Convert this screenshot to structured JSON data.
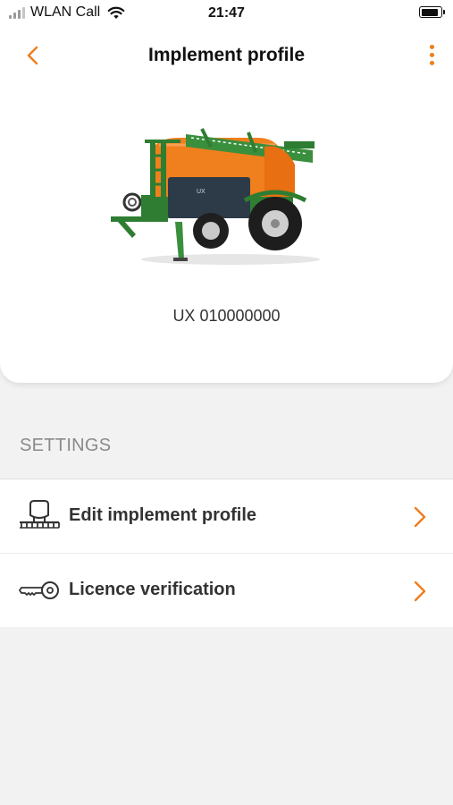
{
  "status_bar": {
    "carrier": "WLAN Call",
    "time": "21:47"
  },
  "header": {
    "title": "Implement profile",
    "back_icon": "chevron-left-icon",
    "more_icon": "vertical-ellipsis-icon"
  },
  "implement": {
    "image": "field-sprayer-image",
    "serial": "UX 010000000"
  },
  "settings": {
    "title": "SETTINGS",
    "items": [
      {
        "label": "Edit implement profile",
        "icon": "implement-icon"
      },
      {
        "label": "Licence verification",
        "icon": "key-icon"
      }
    ]
  },
  "colors": {
    "accent": "#ef7d1a",
    "background": "#f2f2f2",
    "card": "#ffffff"
  }
}
